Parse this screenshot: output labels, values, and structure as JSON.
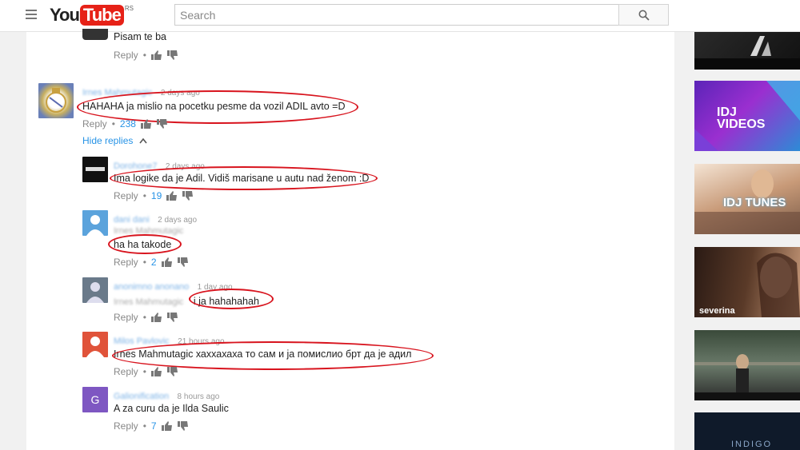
{
  "header": {
    "logo_you": "You",
    "logo_tube": "Tube",
    "logo_region": "RS",
    "search_placeholder": "Search"
  },
  "comments": [
    {
      "text": "Pisam te ba",
      "reply": "Reply",
      "count": ""
    },
    {
      "name": "Irnes Mahmutagic",
      "time": "2 days ago",
      "text": "HAHAHA ja mislio na pocetku pesme da vozil ADIL avto =D",
      "reply": "Reply",
      "count": "238",
      "hide_replies": "Hide replies"
    },
    {
      "name": "Dorohone7",
      "time": "2 days ago",
      "text": "Ima logike da je Adil. Vidiš marisane u autu nad ženom :D",
      "reply": "Reply",
      "count": "19"
    },
    {
      "name": "dani dani",
      "time": "2 days ago",
      "mention": "Irnes Mahmutagic",
      "text": "ha ha takode",
      "reply": "Reply",
      "count": "2"
    },
    {
      "name": "anonimno anonano",
      "time": "1 day ago",
      "mention": "Irnes Mahmutagic",
      "text": "i ja hahahahah",
      "reply": "Reply",
      "count": ""
    },
    {
      "name": "Milos Pavlovic",
      "time": "21 hours ago",
      "text": "Irnes Mahmutagic хаххахаха то сам и ја помислио брт да је адил",
      "reply": "Reply",
      "count": ""
    },
    {
      "name": "Galionification",
      "avatar_letter": "G",
      "time": "8 hours ago",
      "text": "A za curu da je Ilda Saulic",
      "reply": "Reply",
      "count": "7"
    }
  ],
  "sidebar": {
    "thumb2_label": "IDJ VIDEOS",
    "thumb3_label": "IDJ TUNES",
    "thumb4_label": "severina",
    "thumb6_label": "INDIGO"
  },
  "colors": {
    "accent": "#e62117",
    "link": "#2793e6",
    "annotation": "#d8141e"
  }
}
